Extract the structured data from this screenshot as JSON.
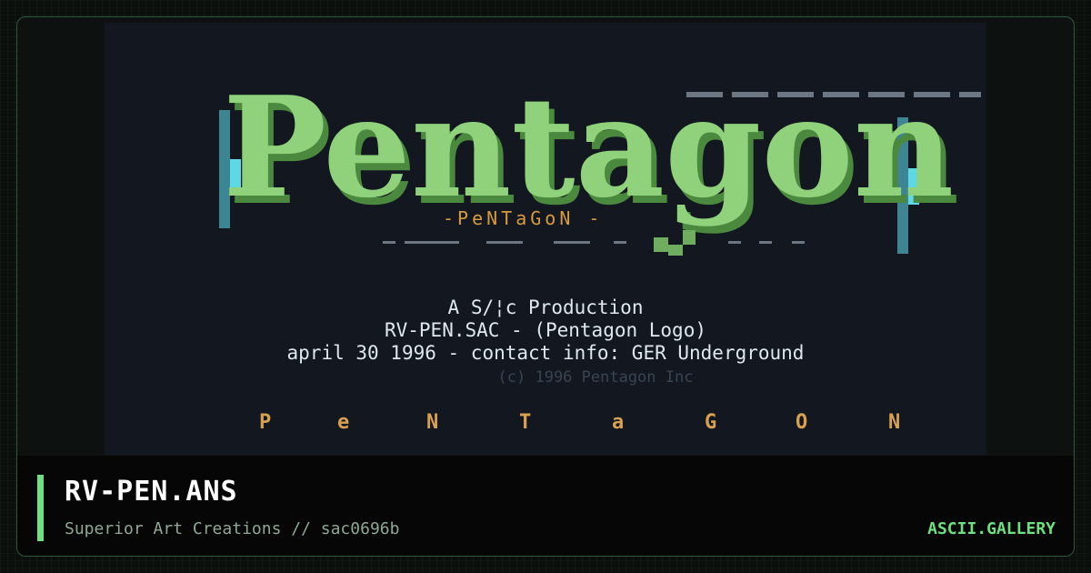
{
  "artwork": {
    "logo_text": "Pentagon",
    "sub_logo": "-PeNTaGoN -",
    "credit_lines": [
      "A S/¦c Production",
      "RV-PEN.SAC - (Pentagon Logo)",
      "april 30 1996 - contact info: GER Underground",
      "(c) 1996 Pentagon Inc"
    ],
    "spread_letters": [
      "P",
      "e",
      "N",
      "T",
      "a",
      "G",
      "O",
      "N"
    ]
  },
  "card": {
    "title": "RV-PEN.ANS",
    "subtitle": "Superior Art Creations // sac0696b",
    "brand": "ASCII.GALLERY"
  },
  "colors": {
    "accent": "#6ee07f",
    "logo_green": "#8fd27b",
    "art_background": "#131820",
    "orange": "#d89a3c",
    "cyan": "#5fd8e6"
  }
}
